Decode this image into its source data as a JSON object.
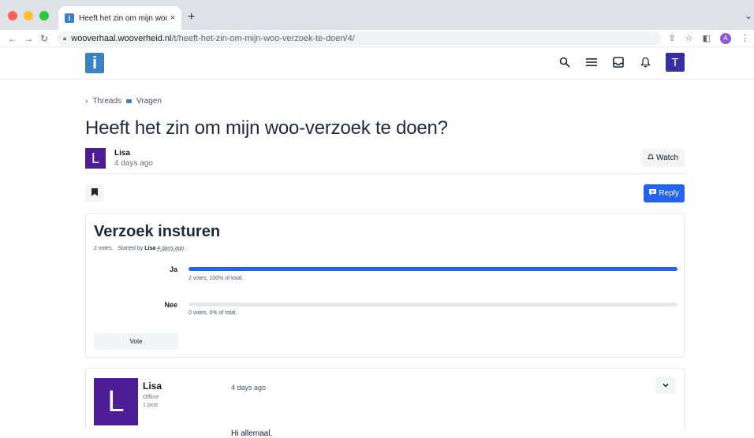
{
  "browser": {
    "tab_title": "Heeft het zin om mijn woo-verz",
    "tab_close": "×",
    "new_tab": "+",
    "tab_dropdown": "⌄",
    "url_host": "wooverhaal.wooverheid.nl",
    "url_path": "/t/heeft-het-zin-om-mijn-woo-verzoek-te-doen/4/",
    "profile_initial": "A"
  },
  "header": {
    "logo_text": "i",
    "user_initial": "T"
  },
  "breadcrumb": {
    "root": "Threads",
    "category": "Vragen"
  },
  "thread": {
    "title": "Heeft het zin om mijn woo-verzoek te doen?",
    "author": "Lisa",
    "author_initial": "L",
    "time": "4 days ago",
    "watch_label": "Watch",
    "reply_label": "Reply"
  },
  "poll": {
    "title": "Verzoek insturen",
    "meta_votes": "2 votes.",
    "meta_started": "Started by",
    "meta_author": "Lisa",
    "meta_time": "4 days ago",
    "options": [
      {
        "label": "Ja",
        "stat": "2 votes, 100% of total.",
        "fraction": 1.0
      },
      {
        "label": "Nee",
        "stat": "0 votes, 0% of total.",
        "fraction": 0.0
      }
    ],
    "vote_label": "Vote"
  },
  "post": {
    "author": "Lisa",
    "author_initial": "L",
    "status": "Offline",
    "post_count": "1 post",
    "time": "4 days ago",
    "body": "Hi allemaal,"
  }
}
